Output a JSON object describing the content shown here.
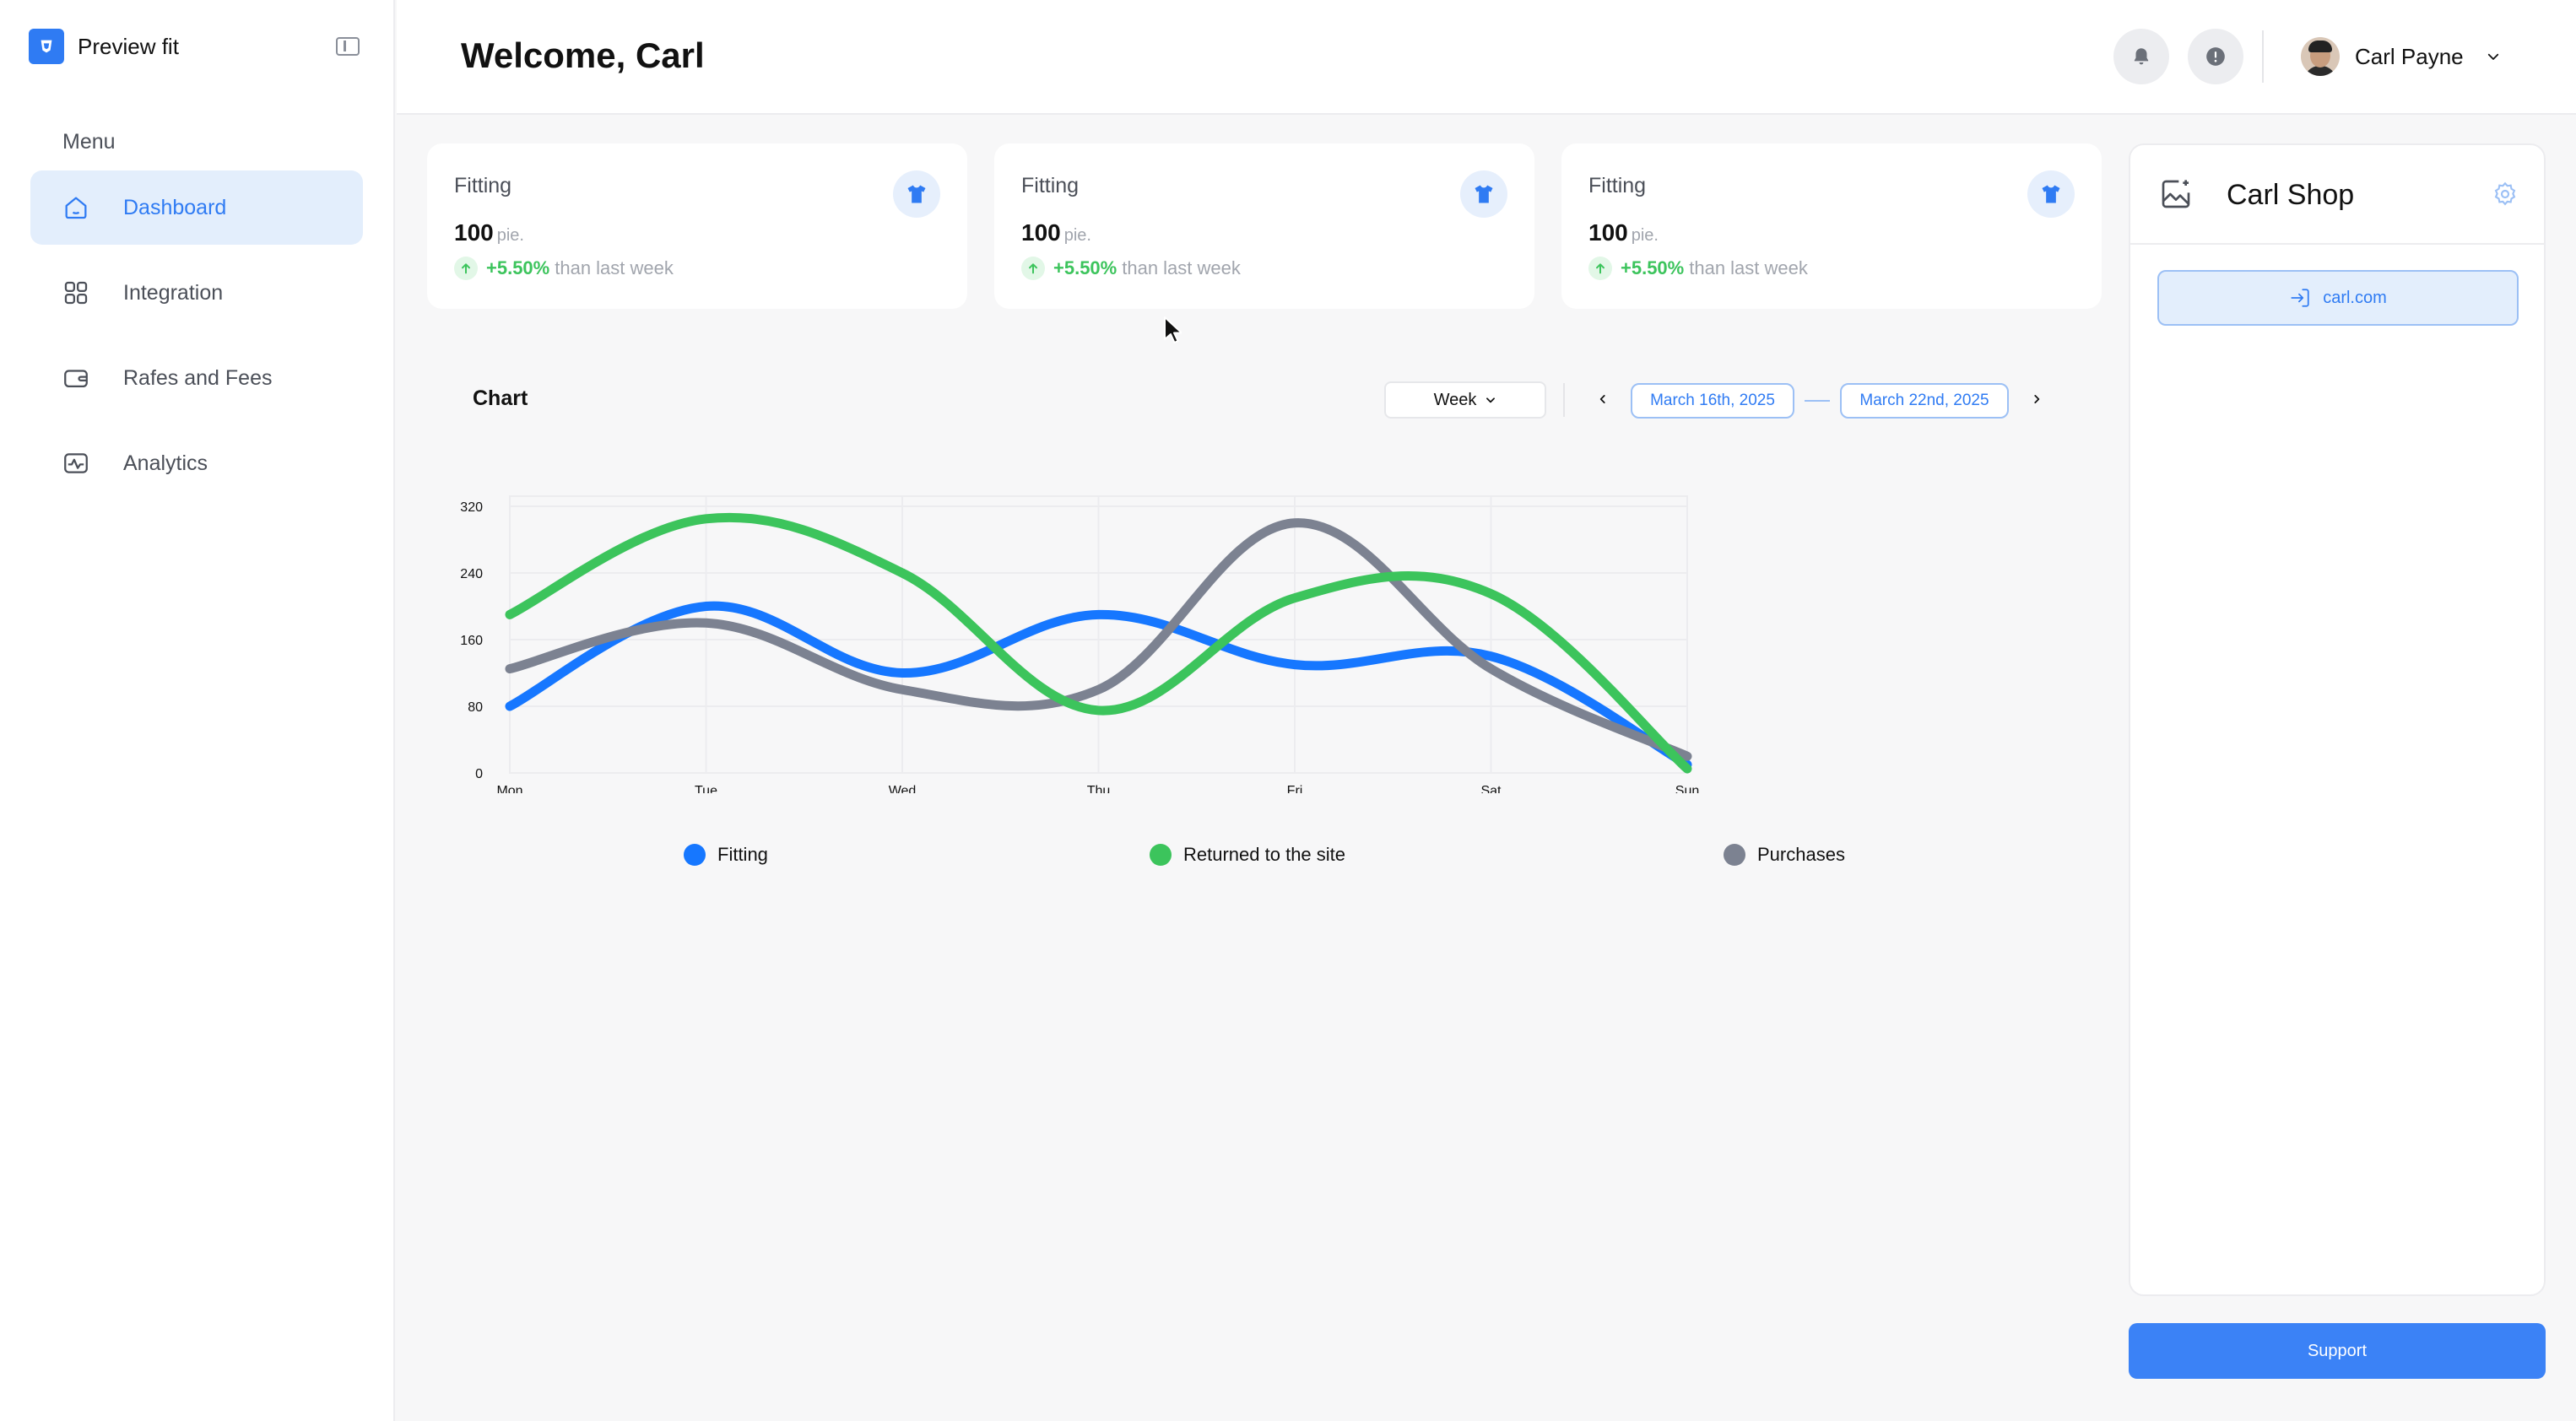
{
  "app": {
    "name": "Preview fit"
  },
  "sidebar": {
    "menu_caption": "Menu",
    "items": [
      {
        "label": "Dashboard",
        "icon": "home-icon",
        "active": true
      },
      {
        "label": "Integration",
        "icon": "grid-icon",
        "active": false
      },
      {
        "label": "Rafes and Fees",
        "icon": "wallet-icon",
        "active": false
      },
      {
        "label": "Analytics",
        "icon": "pulse-icon",
        "active": false
      }
    ]
  },
  "header": {
    "welcome": "Welcome, Carl",
    "user_name": "Carl Payne",
    "icons": [
      "bell-icon",
      "alert-icon"
    ]
  },
  "stats": [
    {
      "title": "Fitting",
      "value": "100",
      "unit": "pie.",
      "change": "+5.50%",
      "comparison": "than last week"
    },
    {
      "title": "Fitting",
      "value": "100",
      "unit": "pie.",
      "change": "+5.50%",
      "comparison": "than last week"
    },
    {
      "title": "Fitting",
      "value": "100",
      "unit": "pie.",
      "change": "+5.50%",
      "comparison": "than last week"
    }
  ],
  "chart_controls": {
    "title": "Chart",
    "period": "Week",
    "date_from": "March 16th, 2025",
    "date_to": "March 22nd, 2025"
  },
  "chart_data": {
    "type": "line",
    "title": "Chart",
    "x": [
      "Mon",
      "Tue",
      "Wed",
      "Thu",
      "Fri",
      "Sat",
      "Sun"
    ],
    "y_ticks": [
      0,
      80,
      160,
      240,
      320
    ],
    "ylim": [
      0,
      320
    ],
    "grid": true,
    "legend_position": "bottom",
    "series": [
      {
        "name": "Fitting",
        "color": "#1677ff",
        "values": [
          80,
          200,
          120,
          190,
          130,
          140,
          10
        ]
      },
      {
        "name": "Returned to the site",
        "color": "#3cc45c",
        "values": [
          190,
          305,
          240,
          75,
          210,
          215,
          5
        ]
      },
      {
        "name": "Purchases",
        "color": "#7c8291",
        "values": [
          125,
          180,
          100,
          100,
          300,
          125,
          20
        ]
      }
    ]
  },
  "shop": {
    "name": "Carl Shop",
    "link": "carl.com",
    "support_label": "Support"
  },
  "colors": {
    "accent": "#2f7bf3",
    "positive": "#3cc45c"
  }
}
